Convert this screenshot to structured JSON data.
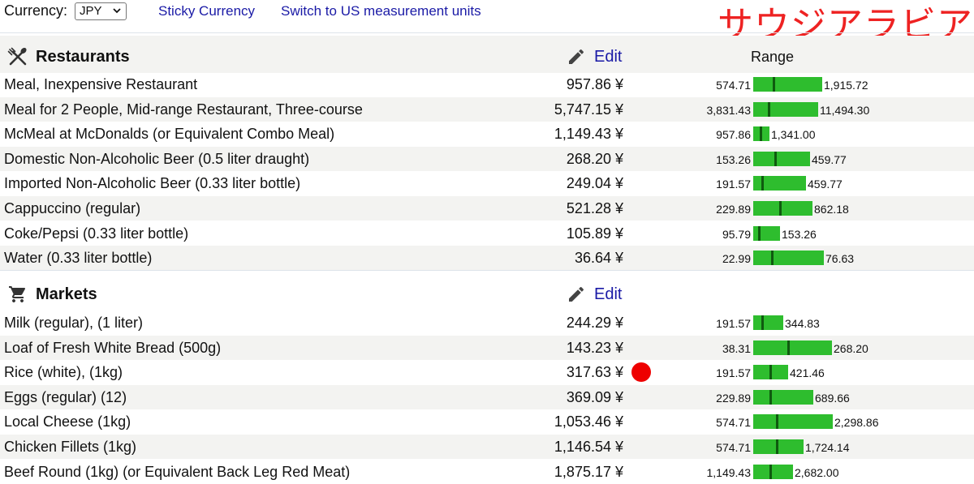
{
  "header": {
    "currency_label": "Currency:",
    "currency_value": "JPY",
    "sticky_link": "Sticky Currency",
    "units_link": "Switch to US measurement units",
    "city_title": "サウジアラビア"
  },
  "sections": [
    {
      "title": "Restaurants",
      "edit": "Edit",
      "range_header": "Range",
      "icon": "utensils-icon",
      "items": [
        {
          "name": "Meal, Inexpensive Restaurant",
          "price": "957.86 ¥",
          "lo": "574.71",
          "hi": "1,915.72"
        },
        {
          "name": "Meal for 2 People, Mid-range Restaurant, Three-course",
          "price": "5,747.15 ¥",
          "lo": "3,831.43",
          "hi": "11,494.30"
        },
        {
          "name": "McMeal at McDonalds (or Equivalent Combo Meal)",
          "price": "1,149.43 ¥",
          "lo": "957.86",
          "hi": "1,341.00"
        },
        {
          "name": "Domestic Non-Alcoholic Beer (0.5 liter draught)",
          "price": "268.20 ¥",
          "lo": "153.26",
          "hi": "459.77"
        },
        {
          "name": "Imported Non-Alcoholic Beer (0.33 liter bottle)",
          "price": "249.04 ¥",
          "lo": "191.57",
          "hi": "459.77"
        },
        {
          "name": "Cappuccino (regular)",
          "price": "521.28 ¥",
          "lo": "229.89",
          "hi": "862.18"
        },
        {
          "name": "Coke/Pepsi (0.33 liter bottle)",
          "price": "105.89 ¥",
          "lo": "95.79",
          "hi": "153.26"
        },
        {
          "name": "Water (0.33 liter bottle)",
          "price": "36.64 ¥",
          "lo": "22.99",
          "hi": "76.63"
        }
      ]
    },
    {
      "title": "Markets",
      "edit": "Edit",
      "range_header": "",
      "icon": "cart-icon",
      "items": [
        {
          "name": "Milk (regular), (1 liter)",
          "price": "244.29 ¥",
          "lo": "191.57",
          "hi": "344.83"
        },
        {
          "name": "Loaf of Fresh White Bread (500g)",
          "price": "143.23 ¥",
          "lo": "38.31",
          "hi": "268.20"
        },
        {
          "name": "Rice (white), (1kg)",
          "price": "317.63 ¥",
          "lo": "191.57",
          "hi": "421.46"
        },
        {
          "name": "Eggs (regular) (12)",
          "price": "369.09 ¥",
          "lo": "229.89",
          "hi": "689.66"
        },
        {
          "name": "Local Cheese (1kg)",
          "price": "1,053.46 ¥",
          "lo": "574.71",
          "hi": "2,298.86"
        },
        {
          "name": "Chicken Fillets (1kg)",
          "price": "1,146.54 ¥",
          "lo": "574.71",
          "hi": "1,724.14"
        },
        {
          "name": "Beef Round (1kg) (or Equivalent Back Leg Red Meat)",
          "price": "1,875.17 ¥",
          "lo": "1,149.43",
          "hi": "2,682.00"
        }
      ]
    }
  ],
  "colors": {
    "bar": "#2ebd2e",
    "marker": "#0f5a0f",
    "link": "#1a1aa6",
    "title_red": "#ee2222",
    "dot": "#ee0000"
  }
}
